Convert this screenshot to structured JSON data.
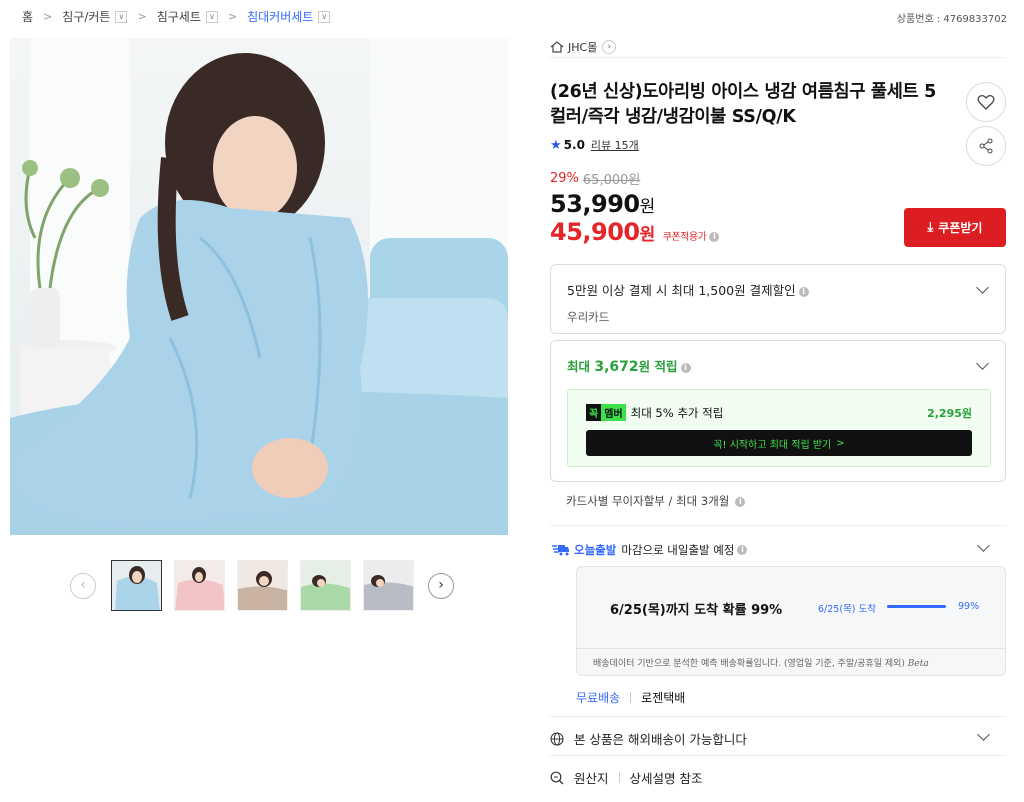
{
  "breadcrumb": [
    {
      "label": "홈",
      "dropdown": false
    },
    {
      "label": "침구/커튼",
      "dropdown": true
    },
    {
      "label": "침구세트",
      "dropdown": true
    },
    {
      "label": "침대커버세트",
      "dropdown": true
    }
  ],
  "product_no": "상품번호 : 4769833702",
  "seller": "JHC몰",
  "title": "(26년 신상)도아리빙 아이스 냉감 여름침구 풀세트 5컬러/즉각 냉감/냉감이불 SS/Q/K",
  "rating": {
    "score": "5.0",
    "review": "리뷰 15개"
  },
  "price": {
    "discount_pct": "29%",
    "original": "65,000원",
    "sale": "53,990",
    "sale_unit": "원",
    "coupon_price": "45,900",
    "coupon_unit": "원",
    "coupon_note": "쿠폰적용가"
  },
  "coupon_button": "쿠폰받기",
  "card_discount": {
    "line1": "5만원 이상 결제 시 최대 1,500원 결제할인",
    "line2": "우리카드"
  },
  "points": {
    "prefix": "최대 ",
    "amount": "3,672",
    "suffix": "원 적립",
    "member_logo_1": "꼭",
    "member_logo_2": "멤버",
    "member_text": "최대 5% 추가 적립",
    "member_amount": "2,295원",
    "member_button": "꼭! 시작하고 최대 적립 받기",
    "member_button_arrow": ">"
  },
  "installment": "카드사별 무이자할부 / 최대 3개월",
  "shipping": {
    "today_label": "오늘출발",
    "message": "마감으로 내일출발 예정",
    "arrival": "6/25(목)까지 도착 확률 99%",
    "bar_label": "6/25(목) 도착",
    "bar_pct_text": "99%",
    "bar_fill": 0.99,
    "note": "배송데이터 기반으로 분석한 예측 배송확률입니다. (영업일 기준, 주말/공휴일 제외)",
    "beta": "Beta",
    "free": "무료배송",
    "carrier": "로젠택배"
  },
  "international": "본 상품은 해외배송이 가능합니다",
  "origin": {
    "label": "원산지",
    "value": "상세설명 참조"
  },
  "colors": {
    "accent_red": "#dc1d22",
    "price_red": "#e52528",
    "blue": "#346aff",
    "green": "#29a03a"
  },
  "thumbnails": [
    "sky-blue",
    "pink",
    "beige",
    "mint",
    "gray"
  ]
}
